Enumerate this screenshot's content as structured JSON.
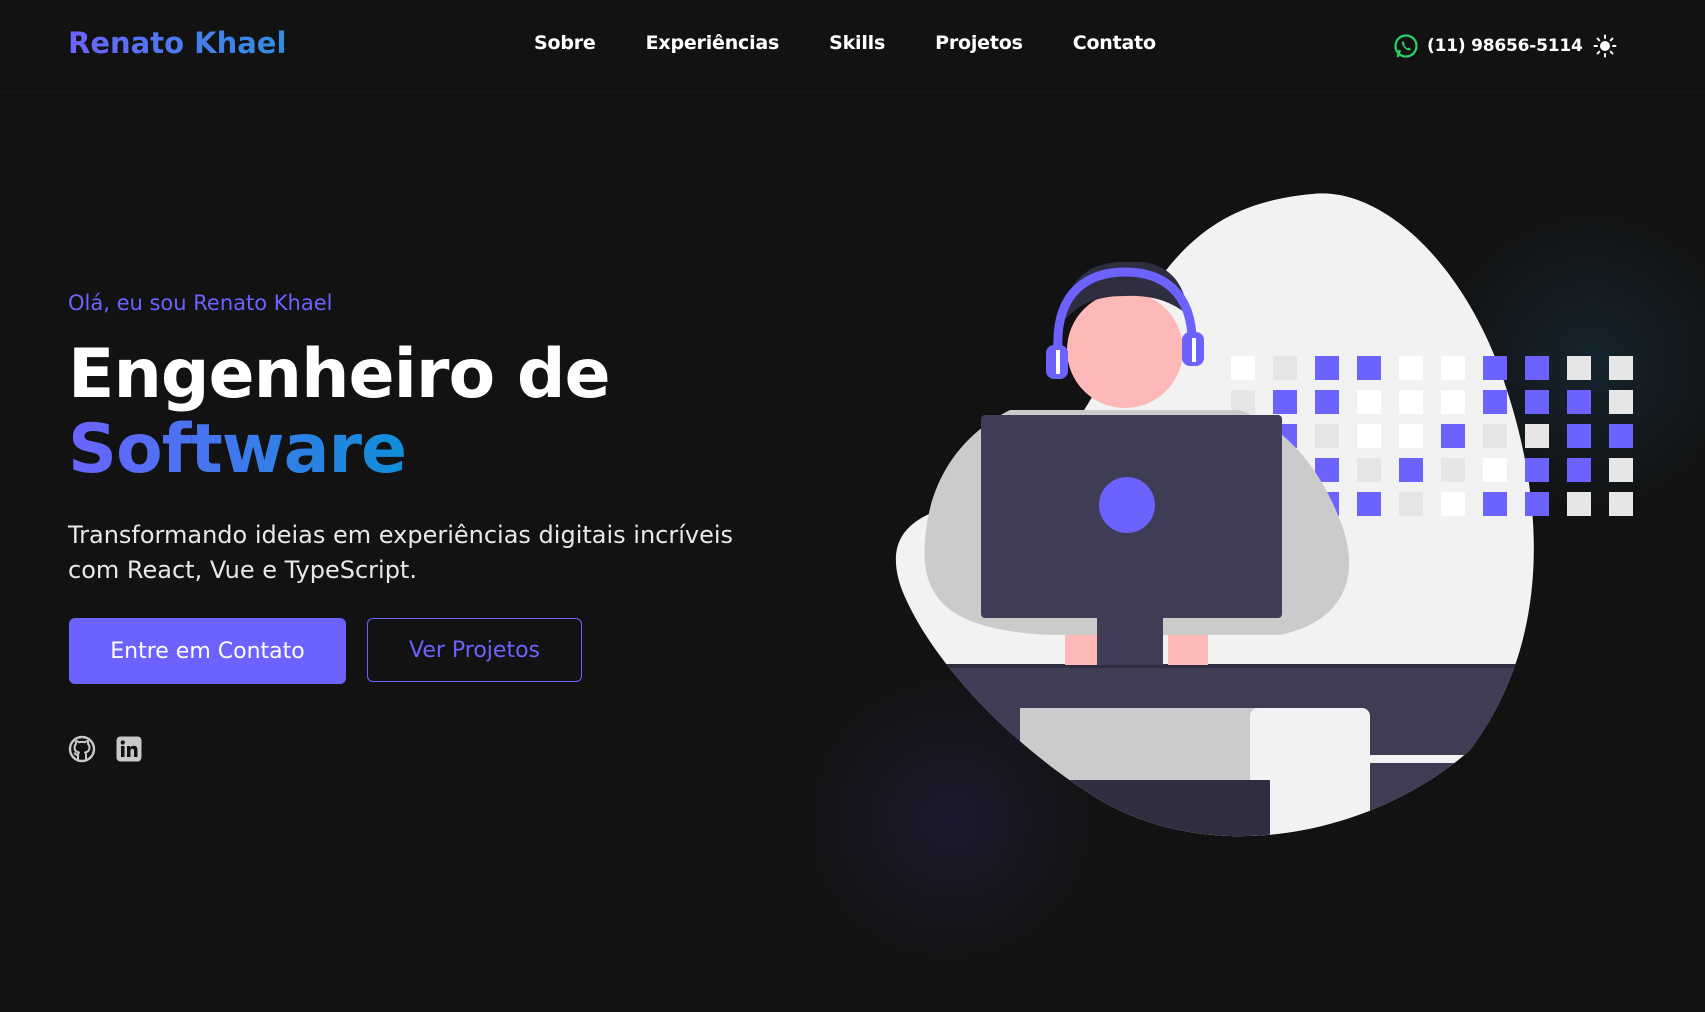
{
  "header": {
    "logo": "Renato Khael",
    "nav": [
      {
        "label": "Sobre"
      },
      {
        "label": "Experiências"
      },
      {
        "label": "Skills"
      },
      {
        "label": "Projetos"
      },
      {
        "label": "Contato"
      }
    ],
    "phone": "(11) 98656-5114",
    "phone_icon": "whatsapp-icon",
    "theme_icon": "sun-icon"
  },
  "hero": {
    "greeting": "Olá, eu sou Renato Khael",
    "title_line1": "Engenheiro de",
    "title_line2": "Software",
    "description": "Transformando ideias em experiências digitais incríveis com React, Vue e TypeScript.",
    "primary_button": "Entre em Contato",
    "secondary_button": "Ver Projetos",
    "social": [
      {
        "icon": "github-icon"
      },
      {
        "icon": "linkedin-icon"
      }
    ]
  },
  "colors": {
    "background": "#121212",
    "accent": "#6c63ff",
    "accent_blue": "#0f8fd8",
    "whatsapp": "#25d366"
  }
}
